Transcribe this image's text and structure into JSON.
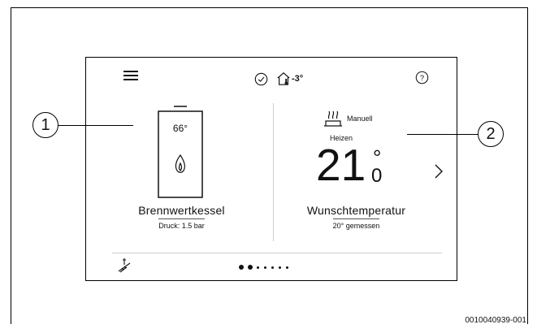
{
  "header": {
    "menu_icon": "hamburger-menu-icon",
    "status_icon": "check-circle-icon",
    "outdoor_icon": "house-thermometer-icon",
    "outdoor_temp": "-3°",
    "help_icon": "question-circle-icon"
  },
  "boiler": {
    "icon": "boiler-icon",
    "temperature": "66°",
    "flame_icon": "flame-icon",
    "name": "Brennwertkessel",
    "pressure": "Druck: 1.5 bar"
  },
  "heating": {
    "mode_icon": "radiator-heat-icon",
    "mode": "Manuell",
    "label": "Heizen",
    "setpoint_int": "21",
    "degree": "°",
    "setpoint_dec": "0",
    "name": "Wunschtemperatur",
    "measured": "20° gemessen"
  },
  "footer": {
    "chimney_icon": "chimney-sweep-icon",
    "pages_total": 7,
    "page_active": 2
  },
  "callouts": {
    "one": "1",
    "two": "2"
  },
  "figure_code": "0010040939-001"
}
